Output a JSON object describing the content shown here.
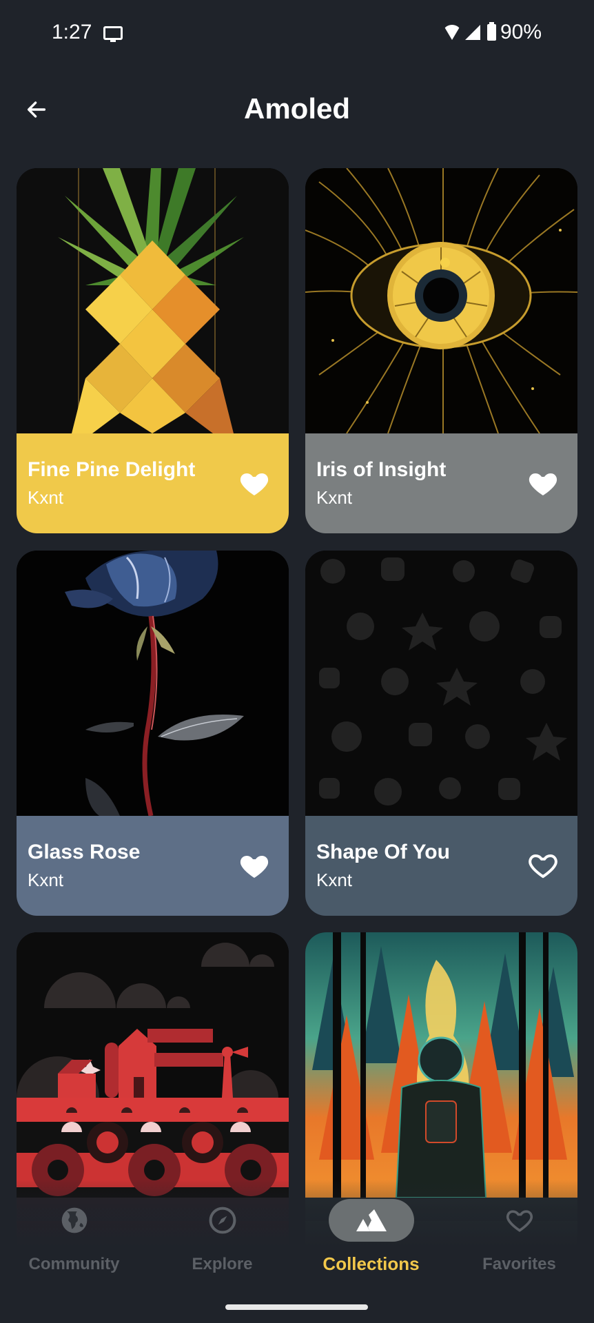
{
  "status_bar": {
    "time": "1:27",
    "battery_percent": "90%",
    "icons": [
      "cast-icon",
      "wifi-icon",
      "cell-signal-icon",
      "battery-icon"
    ]
  },
  "app_bar": {
    "back_icon": "arrow-left-icon",
    "title": "Amoled"
  },
  "wallpapers": [
    {
      "title": "Fine Pine Delight",
      "author": "Kxnt",
      "favorited": true,
      "label_color": "#f0c94a"
    },
    {
      "title": "Iris of Insight",
      "author": "Kxnt",
      "favorited": true,
      "label_color": "#7b7f80"
    },
    {
      "title": "Glass Rose",
      "author": "Kxnt",
      "favorited": true,
      "label_color": "#5e6f87"
    },
    {
      "title": "Shape Of You",
      "author": "Kxnt",
      "favorited": false,
      "label_color": "#4a5a69"
    },
    {
      "title": "",
      "author": "",
      "favorited": null,
      "label_color": "#3a1f24"
    },
    {
      "title": "",
      "author": "",
      "favorited": null,
      "label_color": "#2f3e3c"
    }
  ],
  "bottom_nav": {
    "active_index": 2,
    "active_color": "#f2c84b",
    "items": [
      {
        "label": "Community",
        "icon": "globe-icon"
      },
      {
        "label": "Explore",
        "icon": "compass-icon"
      },
      {
        "label": "Collections",
        "icon": "mountains-icon"
      },
      {
        "label": "Favorites",
        "icon": "heart-outline-icon"
      }
    ]
  }
}
